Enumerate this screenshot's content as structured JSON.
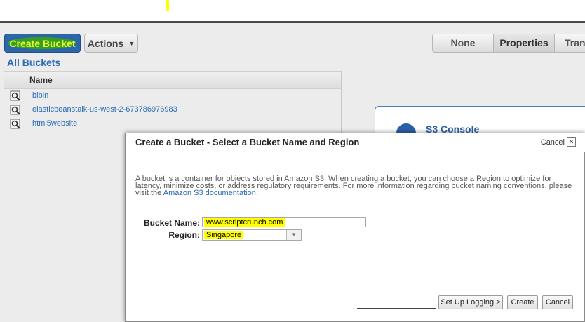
{
  "toolbar": {
    "create_bucket_label": "Create Bucket",
    "actions_label": "Actions",
    "actions_caret": "▼",
    "view_tabs": [
      "None",
      "Properties",
      "Tran"
    ]
  },
  "sidebar": {
    "heading": "All Buckets",
    "column_header": "Name",
    "buckets": [
      "bibin",
      "elasticbeanstalk-us-west-2-673786976983",
      "html5website"
    ]
  },
  "console_panel": {
    "title": "S3 Console"
  },
  "dialog": {
    "title": "Create a Bucket - Select a Bucket Name and Region",
    "cancel_label": "Cancel",
    "close_glyph": "✕",
    "description_text": "A bucket is a container for objects stored in Amazon S3. When creating a bucket, you can choose a Region to optimize for latency, minimize costs, or address regulatory requirements. For more information regarding bucket naming conventions, please visit the ",
    "description_link": "Amazon S3 documentation",
    "description_end": ".",
    "bucket_name_label": "Bucket Name:",
    "bucket_name_value": "www.scriptcrunch.com",
    "region_label": "Region:",
    "region_value": "Singapore",
    "setup_logging_label": "Set Up Logging >",
    "create_label": "Create",
    "cancel_button_label": "Cancel"
  },
  "colors": {
    "primary": "#2b67a8",
    "highlight": "#ffff00",
    "link": "#2a6cb5"
  }
}
